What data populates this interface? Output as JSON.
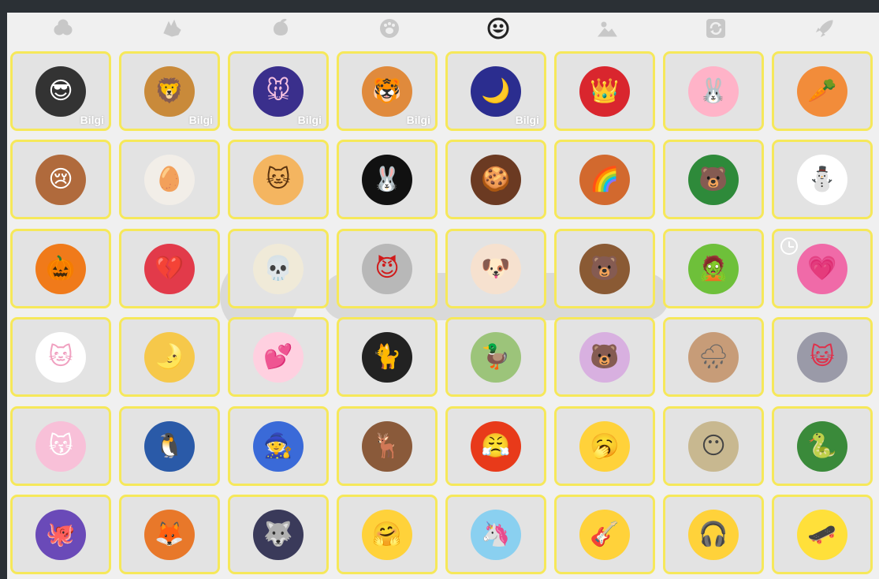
{
  "tabs": [
    {
      "icon": "clover-icon",
      "active": false
    },
    {
      "icon": "wolf-icon",
      "active": false
    },
    {
      "icon": "peach-icon",
      "active": false
    },
    {
      "icon": "paw-icon",
      "active": false
    },
    {
      "icon": "smiley-icon",
      "active": true
    },
    {
      "icon": "landscape-icon",
      "active": false
    },
    {
      "icon": "refresh-icon",
      "active": false
    },
    {
      "icon": "rocket-icon",
      "active": false
    }
  ],
  "colors": {
    "cell_border": "#f6e85a",
    "cell_bg": "#e3e3e3",
    "panel_bg": "#f0f0f0",
    "tab_icon": "#c8c8c8",
    "tab_icon_active": "#222222"
  },
  "stickers": [
    {
      "name": "panda-sunglasses-sticker",
      "badge": "Bilgi",
      "bg": "#333333",
      "fg": "#ffffff",
      "glyph": "😎"
    },
    {
      "name": "lion-costume-sticker",
      "badge": "Bilgi",
      "bg": "#c98a3a",
      "fg": "#5a3310",
      "glyph": "🦁"
    },
    {
      "name": "mouse-space-sticker",
      "badge": "Bilgi",
      "bg": "#3a2f8c",
      "fg": "#f5c0e0",
      "glyph": "🐭"
    },
    {
      "name": "tiger-costume-sticker",
      "badge": "Bilgi",
      "bg": "#e08a3c",
      "fg": "#ffffff",
      "glyph": "🐯"
    },
    {
      "name": "moon-night-sticker",
      "badge": "Bilgi",
      "bg": "#2b2d8f",
      "fg": "#ffd24a",
      "glyph": "🌙"
    },
    {
      "name": "queen-kiss-sticker",
      "badge": "",
      "bg": "#d9262e",
      "fg": "#ffffff",
      "glyph": "👑"
    },
    {
      "name": "pink-bunny-sticker",
      "badge": "",
      "bg": "#ffb3c8",
      "fg": "#c2416b",
      "glyph": "🐰"
    },
    {
      "name": "bunny-carrot-sticker",
      "badge": "",
      "bg": "#f28c3a",
      "fg": "#ffffff",
      "glyph": "🥕"
    },
    {
      "name": "crying-girl-sticker",
      "badge": "",
      "bg": "#b06a3c",
      "fg": "#ffffff",
      "glyph": "😢"
    },
    {
      "name": "cracked-egg-sticker",
      "badge": "",
      "bg": "#f2eee8",
      "fg": "#b03030",
      "glyph": "🥚"
    },
    {
      "name": "dancing-cat-sticker",
      "badge": "",
      "bg": "#f4b560",
      "fg": "#5a3310",
      "glyph": "🐱"
    },
    {
      "name": "black-bunny-hearts-sticker",
      "badge": "",
      "bg": "#111111",
      "fg": "#ff7ab8",
      "glyph": "🐰"
    },
    {
      "name": "gingerbread-sticker",
      "badge": "",
      "bg": "#6b3a22",
      "fg": "#ffffff",
      "glyph": "🍪"
    },
    {
      "name": "deer-rainbow-sticker",
      "badge": "",
      "bg": "#d2692e",
      "fg": "#ffffff",
      "glyph": "🌈"
    },
    {
      "name": "bear-watermelon-sticker",
      "badge": "",
      "bg": "#2e8a3a",
      "fg": "#ffffff",
      "glyph": "🐻"
    },
    {
      "name": "snowman-sticker",
      "badge": "",
      "bg": "#ffffff",
      "fg": "#d82a2a",
      "glyph": "⛄"
    },
    {
      "name": "pumpkin-witch-sticker",
      "badge": "",
      "bg": "#f07a1a",
      "fg": "#222222",
      "glyph": "🎃"
    },
    {
      "name": "sick-heart-sticker",
      "badge": "",
      "bg": "#e23a4a",
      "fg": "#ffffff",
      "glyph": "💔"
    },
    {
      "name": "skull-sticker",
      "badge": "",
      "bg": "#f0ead8",
      "fg": "#333333",
      "glyph": "💀"
    },
    {
      "name": "hockey-mask-sticker",
      "badge": "",
      "bg": "#b8b8b8",
      "fg": "#d01a1a",
      "glyph": "😈"
    },
    {
      "name": "walking-dog-sticker",
      "badge": "",
      "bg": "#f6e1cf",
      "fg": "#d07a5a",
      "glyph": "🐶"
    },
    {
      "name": "pirate-bear-sticker",
      "badge": "",
      "bg": "#8a5a34",
      "fg": "#111111",
      "glyph": "🐻"
    },
    {
      "name": "zombie-face-sticker",
      "badge": "",
      "bg": "#6ec03a",
      "fg": "#ff6aa8",
      "glyph": "🧟"
    },
    {
      "name": "pink-heart-face-sticker",
      "badge": "",
      "bg": "#f06aa8",
      "fg": "#ffffff",
      "glyph": "💗"
    },
    {
      "name": "white-cat-glasses-sticker",
      "badge": "",
      "bg": "#ffffff",
      "fg": "#f0a0c0",
      "glyph": "🐱"
    },
    {
      "name": "bunny-moon-sticker",
      "badge": "",
      "bg": "#f6c84a",
      "fg": "#ffffff",
      "glyph": "🌛"
    },
    {
      "name": "bunny-hearts-sticker",
      "badge": "",
      "bg": "#ffd0e0",
      "fg": "#e0307a",
      "glyph": "💕"
    },
    {
      "name": "black-cat-sticker",
      "badge": "",
      "bg": "#222222",
      "fg": "#ffb0c8",
      "glyph": "🐈"
    },
    {
      "name": "duck-sticker",
      "badge": "",
      "bg": "#9cc47a",
      "fg": "#ffffff",
      "glyph": "🦆"
    },
    {
      "name": "confused-bear-sticker",
      "badge": "",
      "bg": "#d8b0e0",
      "fg": "#8a5a3a",
      "glyph": "🐻"
    },
    {
      "name": "rainy-bear-sticker",
      "badge": "",
      "bg": "#c79c78",
      "fg": "#666666",
      "glyph": "🌧"
    },
    {
      "name": "grey-cat-heart-sticker",
      "badge": "",
      "bg": "#9a9aa8",
      "fg": "#e0304a",
      "glyph": "😺"
    },
    {
      "name": "pink-cat-sleeping-sticker",
      "badge": "",
      "bg": "#f8c0d8",
      "fg": "#ffffff",
      "glyph": "😽"
    },
    {
      "name": "penguin-love-sticker",
      "badge": "",
      "bg": "#2a5aa8",
      "fg": "#ffffff",
      "glyph": "🐧"
    },
    {
      "name": "gnome-heart-sticker",
      "badge": "",
      "bg": "#3a6ad8",
      "fg": "#ff4a6a",
      "glyph": "🧙"
    },
    {
      "name": "reindeer-kid-sticker",
      "badge": "",
      "bg": "#8a5a3a",
      "fg": "#ffe0d0",
      "glyph": "🦌"
    },
    {
      "name": "angry-red-face-sticker",
      "badge": "",
      "bg": "#e83a1a",
      "fg": "#4a0a0a",
      "glyph": "😤"
    },
    {
      "name": "santa-yawn-sticker",
      "badge": "",
      "bg": "#ffd23a",
      "fg": "#8a3aa8",
      "glyph": "🥱"
    },
    {
      "name": "mummy-face-sticker",
      "badge": "",
      "bg": "#c8b890",
      "fg": "#444444",
      "glyph": "😶"
    },
    {
      "name": "medusa-face-sticker",
      "badge": "",
      "bg": "#3a8a3a",
      "fg": "#ffd23a",
      "glyph": "🐍"
    },
    {
      "name": "pirate-octopus-sticker",
      "badge": "",
      "bg": "#6a4ab8",
      "fg": "#111111",
      "glyph": "🐙"
    },
    {
      "name": "fox-sticker",
      "badge": "",
      "bg": "#e8782a",
      "fg": "#ffffff",
      "glyph": "🦊"
    },
    {
      "name": "three-wolves-sticker",
      "badge": "",
      "bg": "#3a3a5a",
      "fg": "#c8c8e8",
      "glyph": "🐺"
    },
    {
      "name": "wov-hug-face-sticker",
      "badge": "",
      "bg": "#ffd23a",
      "fg": "#222222",
      "glyph": "🤗"
    },
    {
      "name": "unicorn-sunglasses-sticker",
      "badge": "",
      "bg": "#8ad0f0",
      "fg": "#a04ad8",
      "glyph": "🦄"
    },
    {
      "name": "hippie-guitar-sticker",
      "badge": "",
      "bg": "#ffd23a",
      "fg": "#8a4a1a",
      "glyph": "🎸"
    },
    {
      "name": "dj-face-sticker",
      "badge": "",
      "bg": "#ffd23a",
      "fg": "#111111",
      "glyph": "🎧"
    },
    {
      "name": "skater-face-sticker",
      "badge": "",
      "bg": "#ffe03a",
      "fg": "#d01a2a",
      "glyph": "🛹"
    }
  ]
}
